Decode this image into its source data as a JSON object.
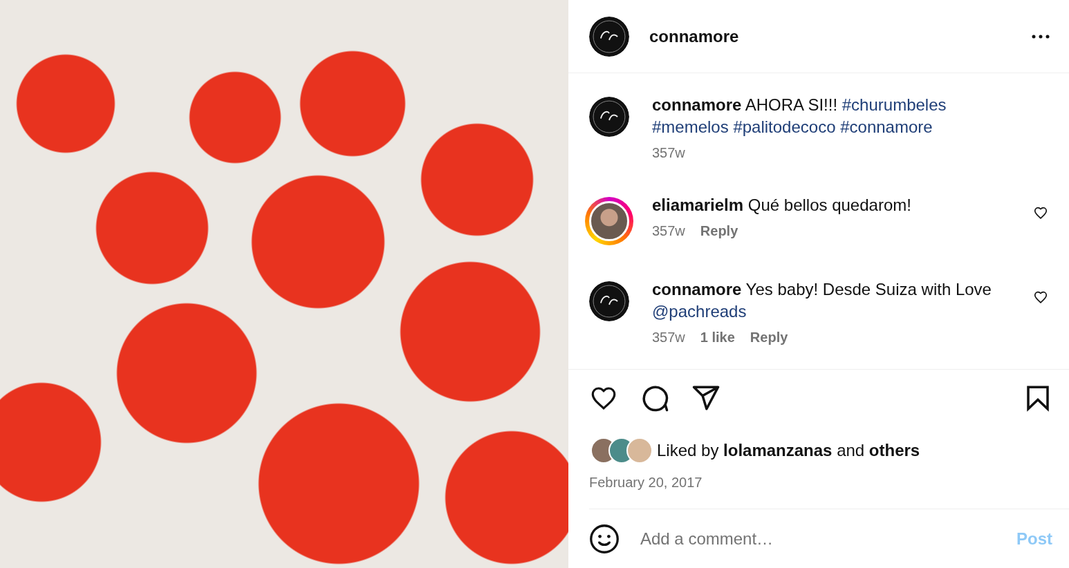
{
  "header": {
    "username": "connamore"
  },
  "caption": {
    "username": "connamore",
    "segments": [
      {
        "kind": "plain",
        "text": "AHORA SI!!!"
      },
      {
        "kind": "link",
        "text": "#churumbeles"
      },
      {
        "kind": "link",
        "text": "#memelos"
      },
      {
        "kind": "link",
        "text": "#palitodecoco"
      },
      {
        "kind": "link",
        "text": "#connamore"
      }
    ],
    "time": "357w"
  },
  "comments": [
    {
      "username": "eliamarielm",
      "kind": "photo",
      "story_ring": true,
      "segments": [
        {
          "kind": "plain",
          "text": "Qué bellos quedarom!"
        }
      ],
      "time": "357w",
      "reply": "Reply",
      "liked": false
    },
    {
      "username": "connamore",
      "kind": "logo",
      "story_ring": false,
      "segments": [
        {
          "kind": "plain",
          "text": "Yes baby! Desde Suiza with Love"
        },
        {
          "kind": "link",
          "text": "@pachreads"
        }
      ],
      "time": "357w",
      "likes": "1 like",
      "reply": "Reply",
      "liked": false
    }
  ],
  "actions": {
    "liked": false,
    "saved": false
  },
  "likes": {
    "text": "Liked by **lolamanzanas** and **others**"
  },
  "date": "February 20, 2017",
  "comment_box": {
    "placeholder": "Add a comment…",
    "post": "Post",
    "post_disabled": true
  }
}
